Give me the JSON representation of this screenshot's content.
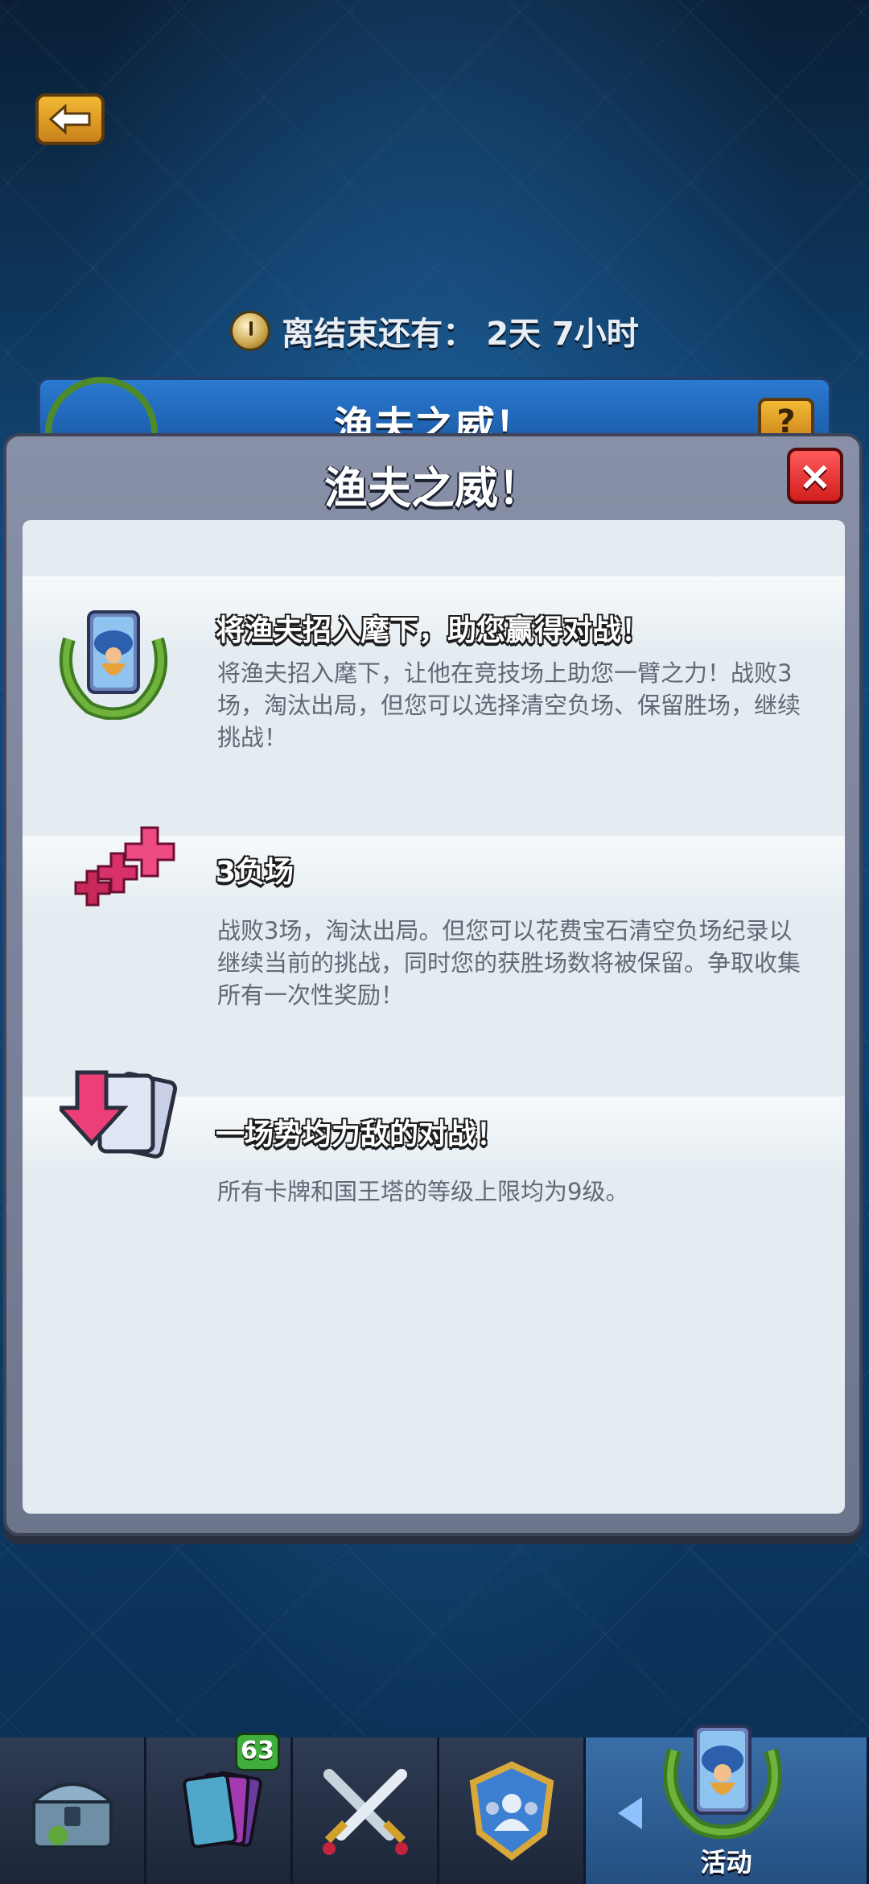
{
  "header": {
    "timer_prefix": "离结束还有：",
    "timer_value": "2天 7小时",
    "banner_title": "渔夫之威！",
    "help_label": "?"
  },
  "modal": {
    "title": "渔夫之威！",
    "close_label": "×",
    "sections": [
      {
        "icon": "fisherman-card-icon",
        "heading": "将渔夫招入麾下，助您赢得对战！",
        "body": "将渔夫招入麾下，让他在竞技场上助您一臂之力！战败3场，淘汰出局，但您可以选择清空负场、保留胜场，继续挑战！"
      },
      {
        "icon": "three-losses-icon",
        "heading": "3负场",
        "body": "战败3场，淘汰出局。但您可以花费宝石清空负场纪录以继续当前的挑战，同时您的获胜场数将被保留。争取收集所有一次性奖励！"
      },
      {
        "icon": "card-level-cap-icon",
        "heading": "一场势均力敌的对战！",
        "body": "所有卡牌和国王塔的等级上限均为9级。"
      }
    ]
  },
  "nav": {
    "cards_badge": "63",
    "events_label": "活动",
    "items": [
      "shop-chest-icon",
      "cards-icon",
      "battle-swords-icon",
      "clan-icon",
      "events-icon"
    ]
  },
  "colors": {
    "background": "#0f416f",
    "panel": "#e4ecf1",
    "modal_frame": "#7a8299",
    "close_red": "#e02a2a",
    "accent_gold": "#f3b935"
  }
}
